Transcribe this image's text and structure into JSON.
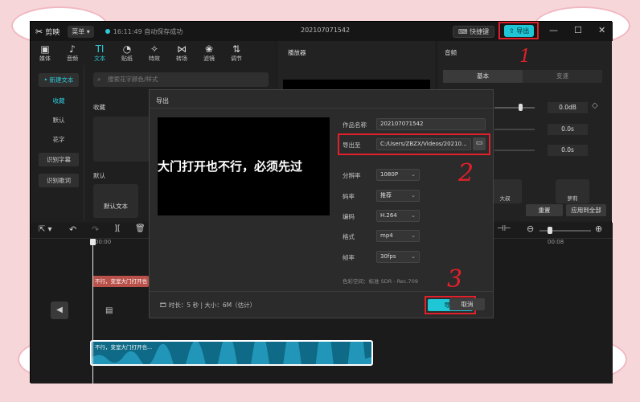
{
  "app": {
    "name": "剪映",
    "menu": "菜单",
    "autosave": "16:11:49 自动保存成功",
    "project_title": "202107071542",
    "shortcut": "快捷键",
    "export": "导出"
  },
  "media_tabs": [
    {
      "label": "媒体",
      "icon": "media-icon"
    },
    {
      "label": "音频",
      "icon": "audio-icon"
    },
    {
      "label": "文本",
      "icon": "text-icon"
    },
    {
      "label": "贴纸",
      "icon": "sticker-icon"
    },
    {
      "label": "特效",
      "icon": "effects-icon"
    },
    {
      "label": "转场",
      "icon": "transition-icon"
    },
    {
      "label": "滤镜",
      "icon": "filter-icon"
    },
    {
      "label": "调节",
      "icon": "adjust-icon"
    }
  ],
  "side_items": [
    "• 新建文本",
    "收藏",
    "默认",
    "花字",
    "识别字幕",
    "识别歌词"
  ],
  "search_placeholder": "搜索花字颜色/样式",
  "section_collect": "收藏",
  "section_default": "默认",
  "default_text_tile": "默认文本",
  "player_title": "播放器",
  "audio_panel": {
    "title": "音频",
    "tabs": [
      "基本",
      "变速"
    ],
    "values": [
      "0.0dB",
      "0.0s",
      "0.0s"
    ],
    "buttons": [
      "重置",
      "应用到全部"
    ],
    "preset_labels": [
      "大叔",
      "萝莉"
    ]
  },
  "dialog": {
    "title": "导出",
    "preview_text": "大门打开也不行，必须先过",
    "name_label": "作品名称",
    "name_value": "202107071542",
    "export_to_label": "导出至",
    "export_path": "C:/Users/ZBZX/Videos/20210...",
    "resolution_label": "分辨率",
    "resolution_value": "1080P",
    "bitrate_label": "码率",
    "bitrate_value": "推荐",
    "encoding_label": "编码",
    "encoding_value": "H.264",
    "format_label": "格式",
    "format_value": "mp4",
    "fps_label": "帧率",
    "fps_value": "30fps",
    "colorspace": "色彩空间：标准 SDR - Rec.709",
    "info": "时长：5 秒 | 大小：6M（估计）",
    "export_btn": "导出",
    "cancel_btn": "取消"
  },
  "timeline": {
    "time_start": "00:00",
    "time_end": "00:08",
    "text_clip": "不行，变室大门打开也",
    "audio_clip": "不行，变室大门打开也..."
  },
  "annotations": [
    "1",
    "2",
    "3"
  ],
  "colors": {
    "accent": "#1fc7d6",
    "highlight": "#e0202a",
    "bg_pink": "#f7d6d9"
  }
}
